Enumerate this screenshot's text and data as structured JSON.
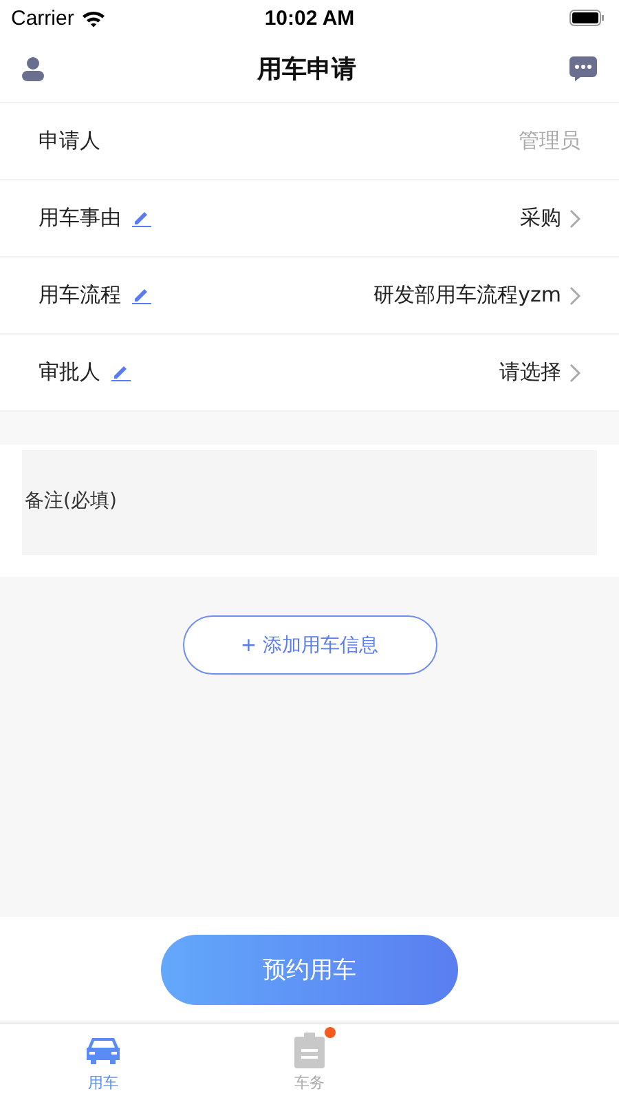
{
  "status_bar": {
    "carrier": "Carrier",
    "time": "10:02 AM"
  },
  "nav": {
    "title": "用车申请"
  },
  "form_rows": [
    {
      "label": "申请人",
      "value": "管理员",
      "kind": "static"
    },
    {
      "label": "用车事由",
      "value": "采购",
      "kind": "select"
    },
    {
      "label": "用车流程",
      "value": "研发部用车流程yzm",
      "kind": "select"
    },
    {
      "label": "审批人",
      "value": "请选择",
      "kind": "select"
    }
  ],
  "remark": {
    "placeholder": "备注(必填)"
  },
  "add_button": "+ 添加用车信息",
  "submit_button": "预约用车",
  "tabs": [
    {
      "label": "用车",
      "selected": true,
      "kind": "car",
      "badge": false
    },
    {
      "label": "车务",
      "selected": false,
      "kind": "clipboard",
      "badge": true
    }
  ]
}
